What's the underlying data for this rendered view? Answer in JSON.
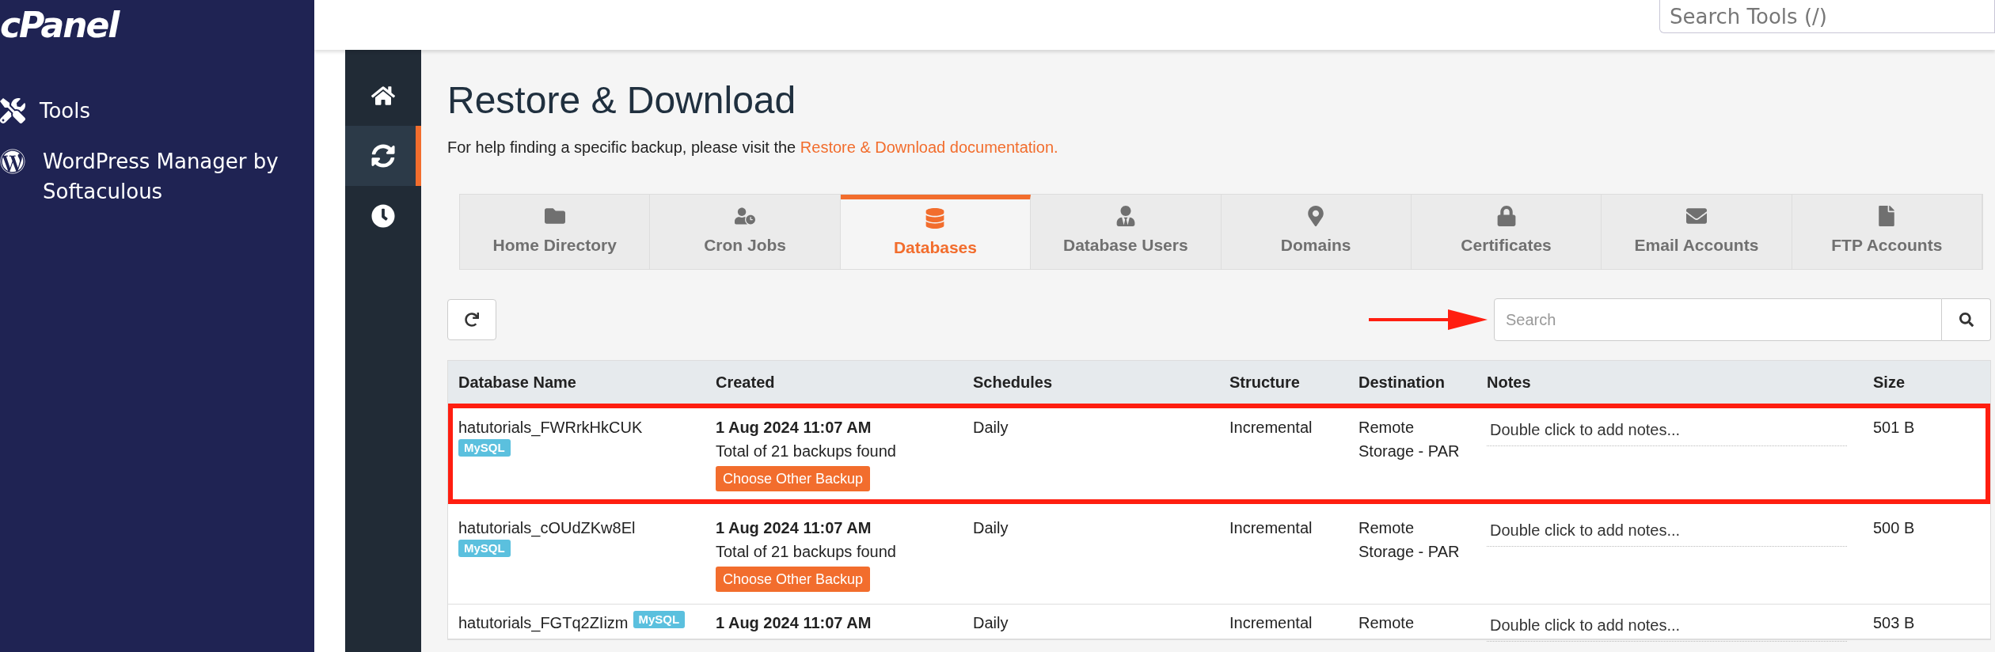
{
  "brand": {
    "logo": "cPanel"
  },
  "top_bar": {
    "search": {
      "placeholder": "Search Tools (/)"
    }
  },
  "sidebar": {
    "items": [
      {
        "kind": "tools",
        "label": "Tools"
      },
      {
        "kind": "wordpress",
        "label": "WordPress Manager by Softaculous"
      }
    ]
  },
  "icon_rail": {
    "items": [
      {
        "kind": "home",
        "selected": false
      },
      {
        "kind": "sync",
        "selected": true
      },
      {
        "kind": "clock",
        "selected": false
      }
    ]
  },
  "page": {
    "title": "Restore & Download",
    "help_text": "For help finding a specific backup, please visit the ",
    "help_link": "Restore & Download documentation."
  },
  "tabs": [
    {
      "kind": "folder",
      "label": "Home Directory",
      "selected": false
    },
    {
      "kind": "user-clock",
      "label": "Cron Jobs",
      "selected": false
    },
    {
      "kind": "database",
      "label": "Databases",
      "selected": true
    },
    {
      "kind": "user",
      "label": "Database Users",
      "selected": false
    },
    {
      "kind": "marker",
      "label": "Domains",
      "selected": false
    },
    {
      "kind": "lock",
      "label": "Certificates",
      "selected": false
    },
    {
      "kind": "envelope",
      "label": "Email Accounts",
      "selected": false
    },
    {
      "kind": "file",
      "label": "FTP Accounts",
      "selected": false
    }
  ],
  "search": {
    "placeholder": "Search"
  },
  "table": {
    "columns": [
      "Database Name",
      "Created",
      "Schedules",
      "Structure",
      "Destination",
      "Notes",
      "Size"
    ],
    "rows": [
      {
        "name": "hatutorials_FWRrkHkCUK",
        "badge": "MySQL",
        "created": "1 Aug 2024 11:07 AM",
        "backups_found": "Total of 21 backups found",
        "button": "Choose Other Backup",
        "schedule": "Daily",
        "structure": "Incremental",
        "destination": "Remote Storage - PAR",
        "notes": "Double click to add notes...",
        "size": "501 B",
        "highlighted": true
      },
      {
        "name": "hatutorials_cOUdZKw8El",
        "badge": "MySQL",
        "created": "1 Aug 2024 11:07 AM",
        "backups_found": "Total of 21 backups found",
        "button": "Choose Other Backup",
        "schedule": "Daily",
        "structure": "Incremental",
        "destination": "Remote Storage - PAR",
        "notes": "Double click to add notes...",
        "size": "500 B",
        "highlighted": false
      },
      {
        "name": "hatutorials_FGTq2ZIizm",
        "badge": "MySQL",
        "created": "1 Aug 2024 11:07 AM",
        "schedule": "Daily",
        "structure": "Incremental",
        "destination": "Remote",
        "notes": "Double click to add notes...",
        "size": "503 B",
        "highlighted": false
      }
    ]
  }
}
